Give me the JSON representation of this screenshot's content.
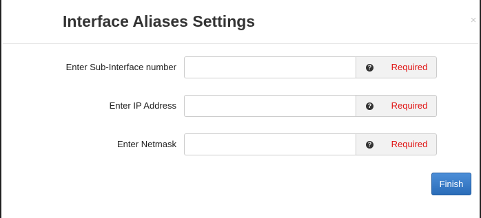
{
  "dialog": {
    "title": "Interface Aliases Settings",
    "close_glyph": "×"
  },
  "form": {
    "rows": [
      {
        "label": "Enter Sub-Interface number",
        "value": "",
        "help_glyph": "?",
        "status": "Required"
      },
      {
        "label": "Enter IP Address",
        "value": "",
        "help_glyph": "?",
        "status": "Required"
      },
      {
        "label": "Enter Netmask",
        "value": "",
        "help_glyph": "?",
        "status": "Required"
      }
    ],
    "finish_label": "Finish"
  },
  "colors": {
    "required_text": "#e01515",
    "primary_button": "#2a6cb8",
    "addon_background": "#f2f2f2"
  },
  "icons": {
    "close": "close-icon",
    "help": "question-circle-icon"
  }
}
